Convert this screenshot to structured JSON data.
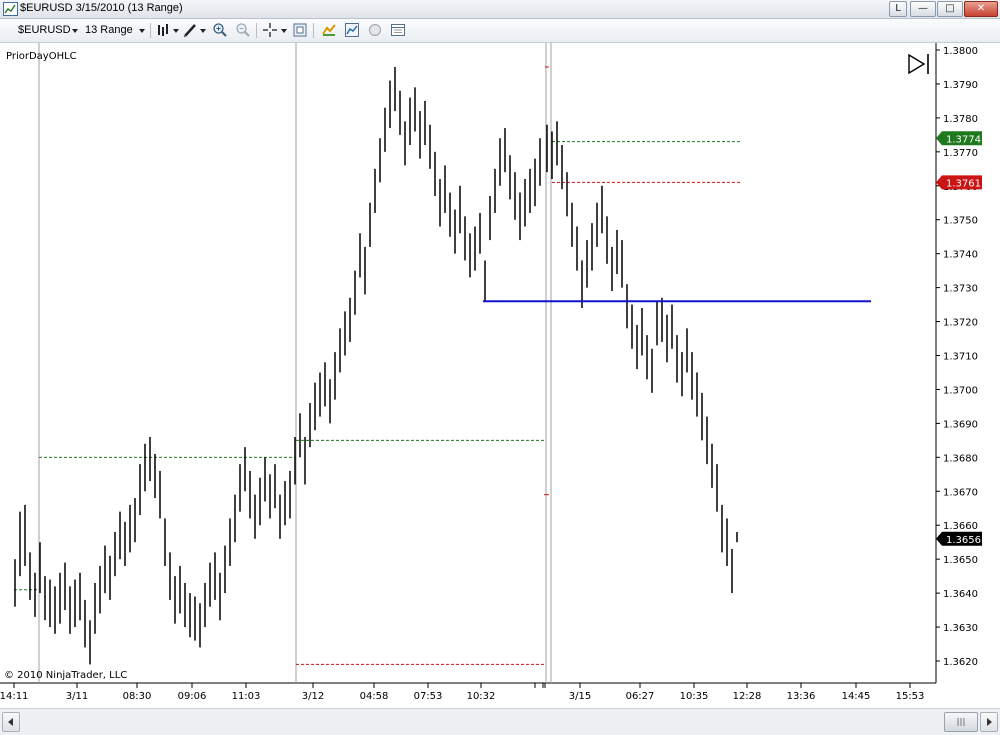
{
  "window": {
    "title": "$EURUSD  3/15/2010 (13 Range)",
    "buttons": {
      "link": "L",
      "minimize": "—",
      "maximize": "□",
      "close": "✕"
    }
  },
  "toolbar": {
    "instrument": "$EURUSD",
    "interval": "13 Range",
    "icons": [
      "bar-type-icon",
      "draw-pen-icon",
      "zoom-in-icon",
      "zoom-out-icon",
      "crosshair-icon",
      "data-box-icon",
      "strategies-icon",
      "indicators-icon",
      "properties-icon",
      "chart-trader-icon"
    ]
  },
  "chart": {
    "indicator_label": "PriorDayOHLC",
    "copyright": "© 2010 NinjaTrader, LLC",
    "price_axis": [
      "1.3800",
      "1.3790",
      "1.3780",
      "1.3770",
      "1.3760",
      "1.3750",
      "1.3740",
      "1.3730",
      "1.3720",
      "1.3710",
      "1.3700",
      "1.3690",
      "1.3680",
      "1.3670",
      "1.3660",
      "1.3650",
      "1.3640",
      "1.3630",
      "1.3620"
    ],
    "time_axis": [
      "14:11",
      "3/11",
      "08:30",
      "09:06",
      "11:03",
      "3/12",
      "04:58",
      "07:53",
      "10:32",
      "3/15",
      "06:27",
      "10:35",
      "12:28",
      "13:36",
      "14:45",
      "15:53"
    ],
    "markers": [
      {
        "value": "1.3774",
        "color": "#1f7a1f"
      },
      {
        "value": "1.3761",
        "color": "#cc1414"
      },
      {
        "value": "1.3656",
        "color": "#000000"
      }
    ],
    "horizontal_line": {
      "price": 1.3726,
      "color": "#1414c8"
    },
    "colors": {
      "bar": "#000000",
      "high_line": "#1f7a1f",
      "low_line": "#cc1414",
      "session": "#a0a0a0"
    }
  }
}
